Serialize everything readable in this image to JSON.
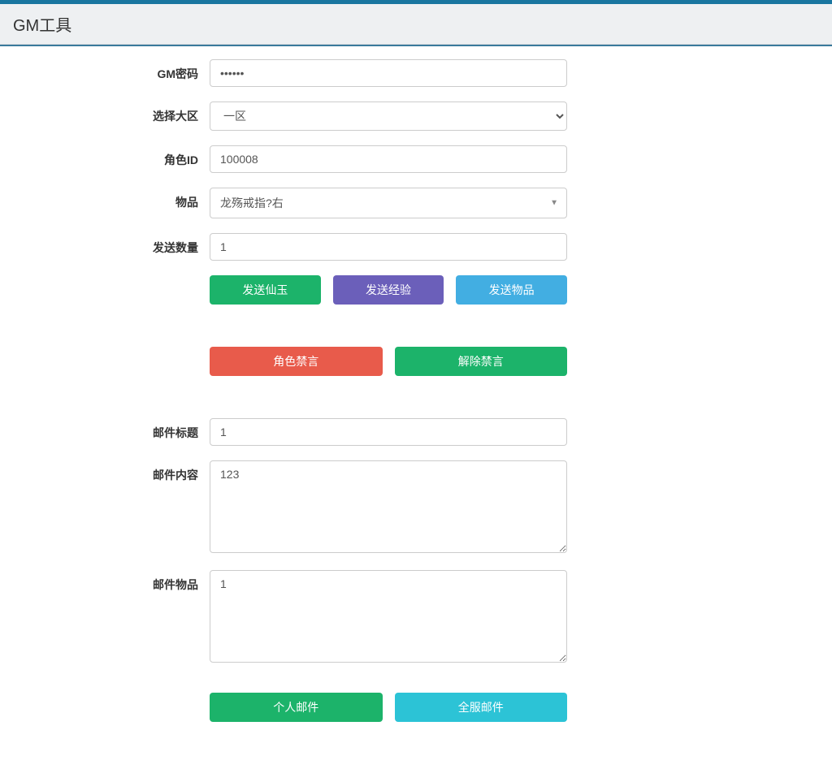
{
  "header": {
    "title": "GM工具"
  },
  "form": {
    "gm_password": {
      "label": "GM密码",
      "value": "••••••"
    },
    "region": {
      "label": "选择大区",
      "selected": "一区"
    },
    "role_id": {
      "label": "角色ID",
      "value": "100008"
    },
    "item": {
      "label": "物品",
      "selected": "龙殇戒指?右"
    },
    "send_qty": {
      "label": "发送数量",
      "value": "1"
    },
    "mail_title": {
      "label": "邮件标题",
      "value": "1"
    },
    "mail_body": {
      "label": "邮件内容",
      "value": "123"
    },
    "mail_items": {
      "label": "邮件物品",
      "value": "1"
    }
  },
  "buttons": {
    "send_xianyu": "发送仙玉",
    "send_exp": "发送经验",
    "send_item": "发送物品",
    "role_mute": "角色禁言",
    "unmute": "解除禁言",
    "personal_mail": "个人邮件",
    "server_mail": "全服邮件"
  }
}
